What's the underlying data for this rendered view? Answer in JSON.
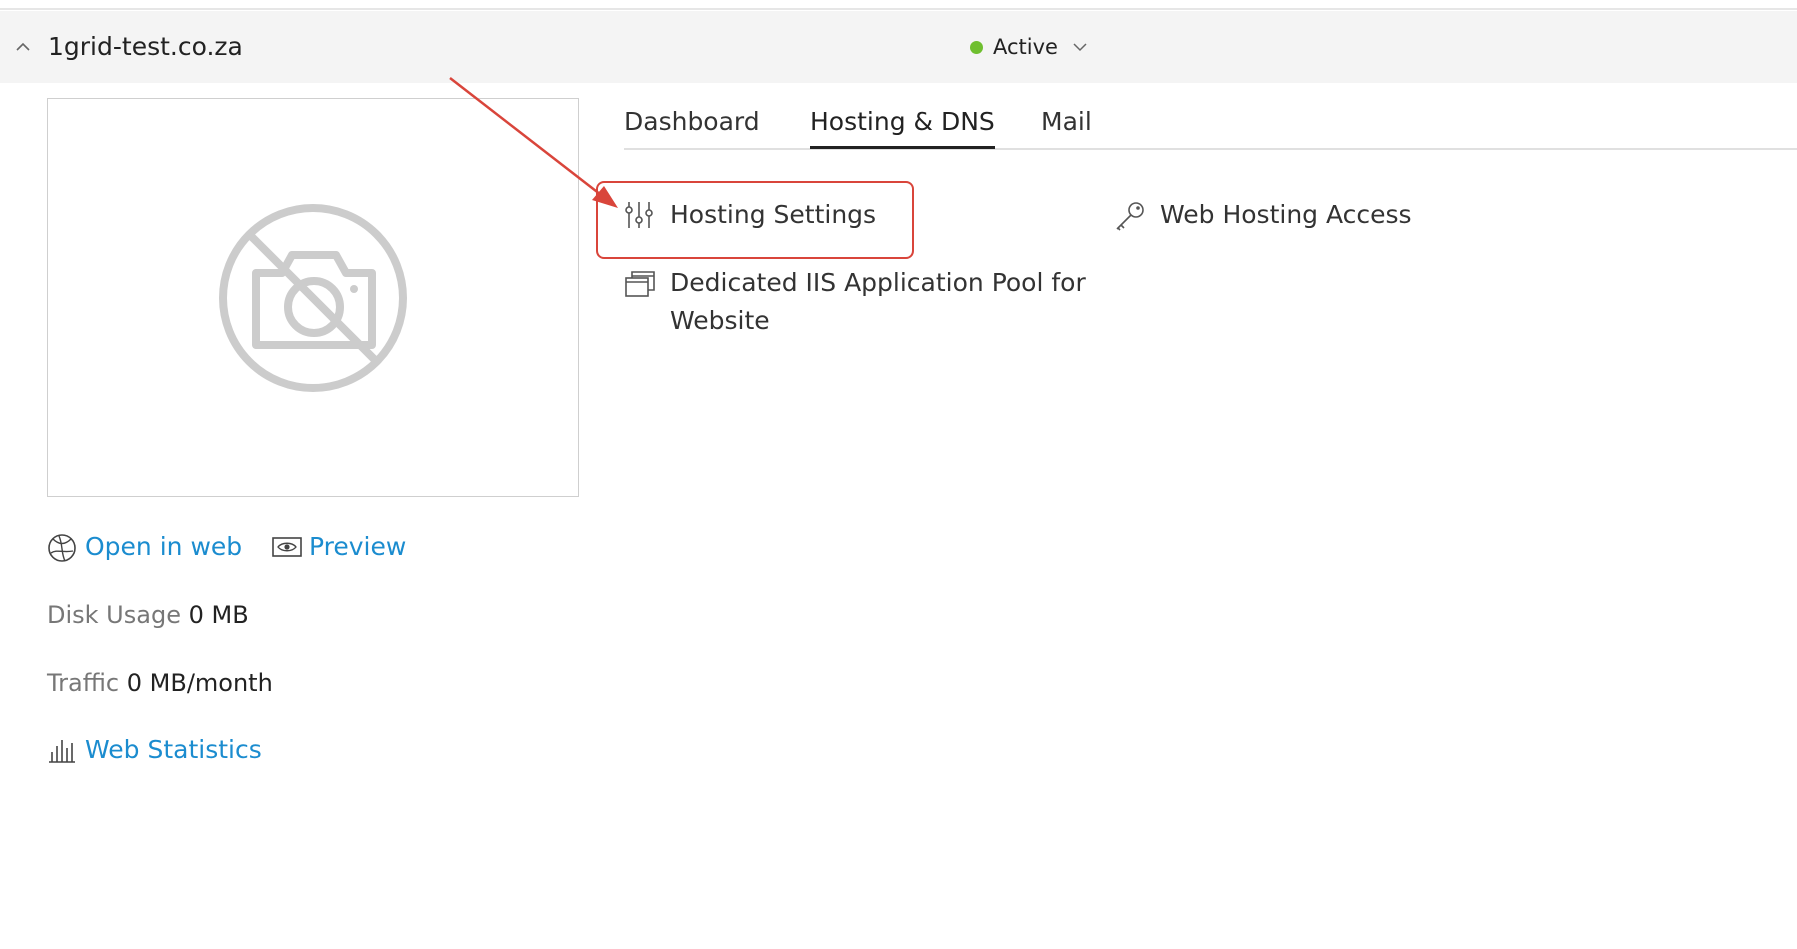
{
  "domain": {
    "name": "1grid-test.co.za",
    "collapse_icon": "chevron-up-icon"
  },
  "status": {
    "label": "Active",
    "dot_color": "#6fbf2f",
    "dropdown_icon": "chevron-down-icon"
  },
  "thumbnail": {
    "icon": "no-camera-icon"
  },
  "tabs": [
    {
      "label": "Dashboard",
      "active": false
    },
    {
      "label": "Hosting & DNS",
      "active": true
    },
    {
      "label": "Mail",
      "active": false
    }
  ],
  "hosting_items": {
    "hosting_settings": {
      "label": "Hosting Settings",
      "icon": "sliders-icon"
    },
    "web_hosting_access": {
      "label": "Web Hosting Access",
      "icon": "key-icon"
    },
    "app_pool": {
      "label": "Dedicated IIS Application Pool for Website",
      "icon": "windows-stack-icon"
    }
  },
  "annotation": {
    "highlight_color": "#d9453b",
    "target": "Hosting Settings"
  },
  "site_links": {
    "open_in_web": {
      "label": "Open in web",
      "icon": "globe-icon"
    },
    "preview": {
      "label": "Preview",
      "icon": "eye-icon"
    },
    "link_color": "#1b8ccf"
  },
  "stats": {
    "disk_label": "Disk Usage",
    "disk_value": "0 MB",
    "traffic_label": "Traffic",
    "traffic_value": "0 MB/month"
  },
  "web_statistics": {
    "label": "Web Statistics",
    "icon": "bar-chart-icon"
  }
}
